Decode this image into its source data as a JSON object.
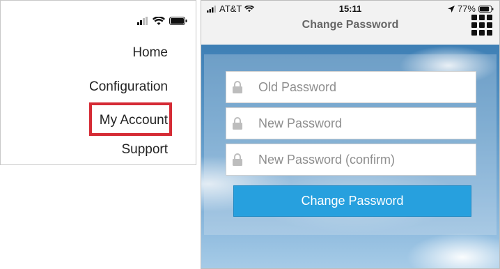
{
  "menu": {
    "items": [
      {
        "label": "Home"
      },
      {
        "label": "Configuration"
      },
      {
        "label": "My Account"
      },
      {
        "label": "Support"
      }
    ],
    "highlight_color": "#d52b35"
  },
  "phone": {
    "status": {
      "carrier": "AT&T",
      "time": "15:11",
      "battery": "77%"
    },
    "nav": {
      "title": "Change Password",
      "menu_icon": "grid-icon"
    },
    "form": {
      "fields": [
        {
          "placeholder": "Old Password",
          "icon": "lock-icon"
        },
        {
          "placeholder": "New Password",
          "icon": "lock-icon"
        },
        {
          "placeholder": "New Password (confirm)",
          "icon": "lock-icon"
        }
      ],
      "submit_label": "Change Password",
      "submit_color": "#27a0de"
    }
  }
}
